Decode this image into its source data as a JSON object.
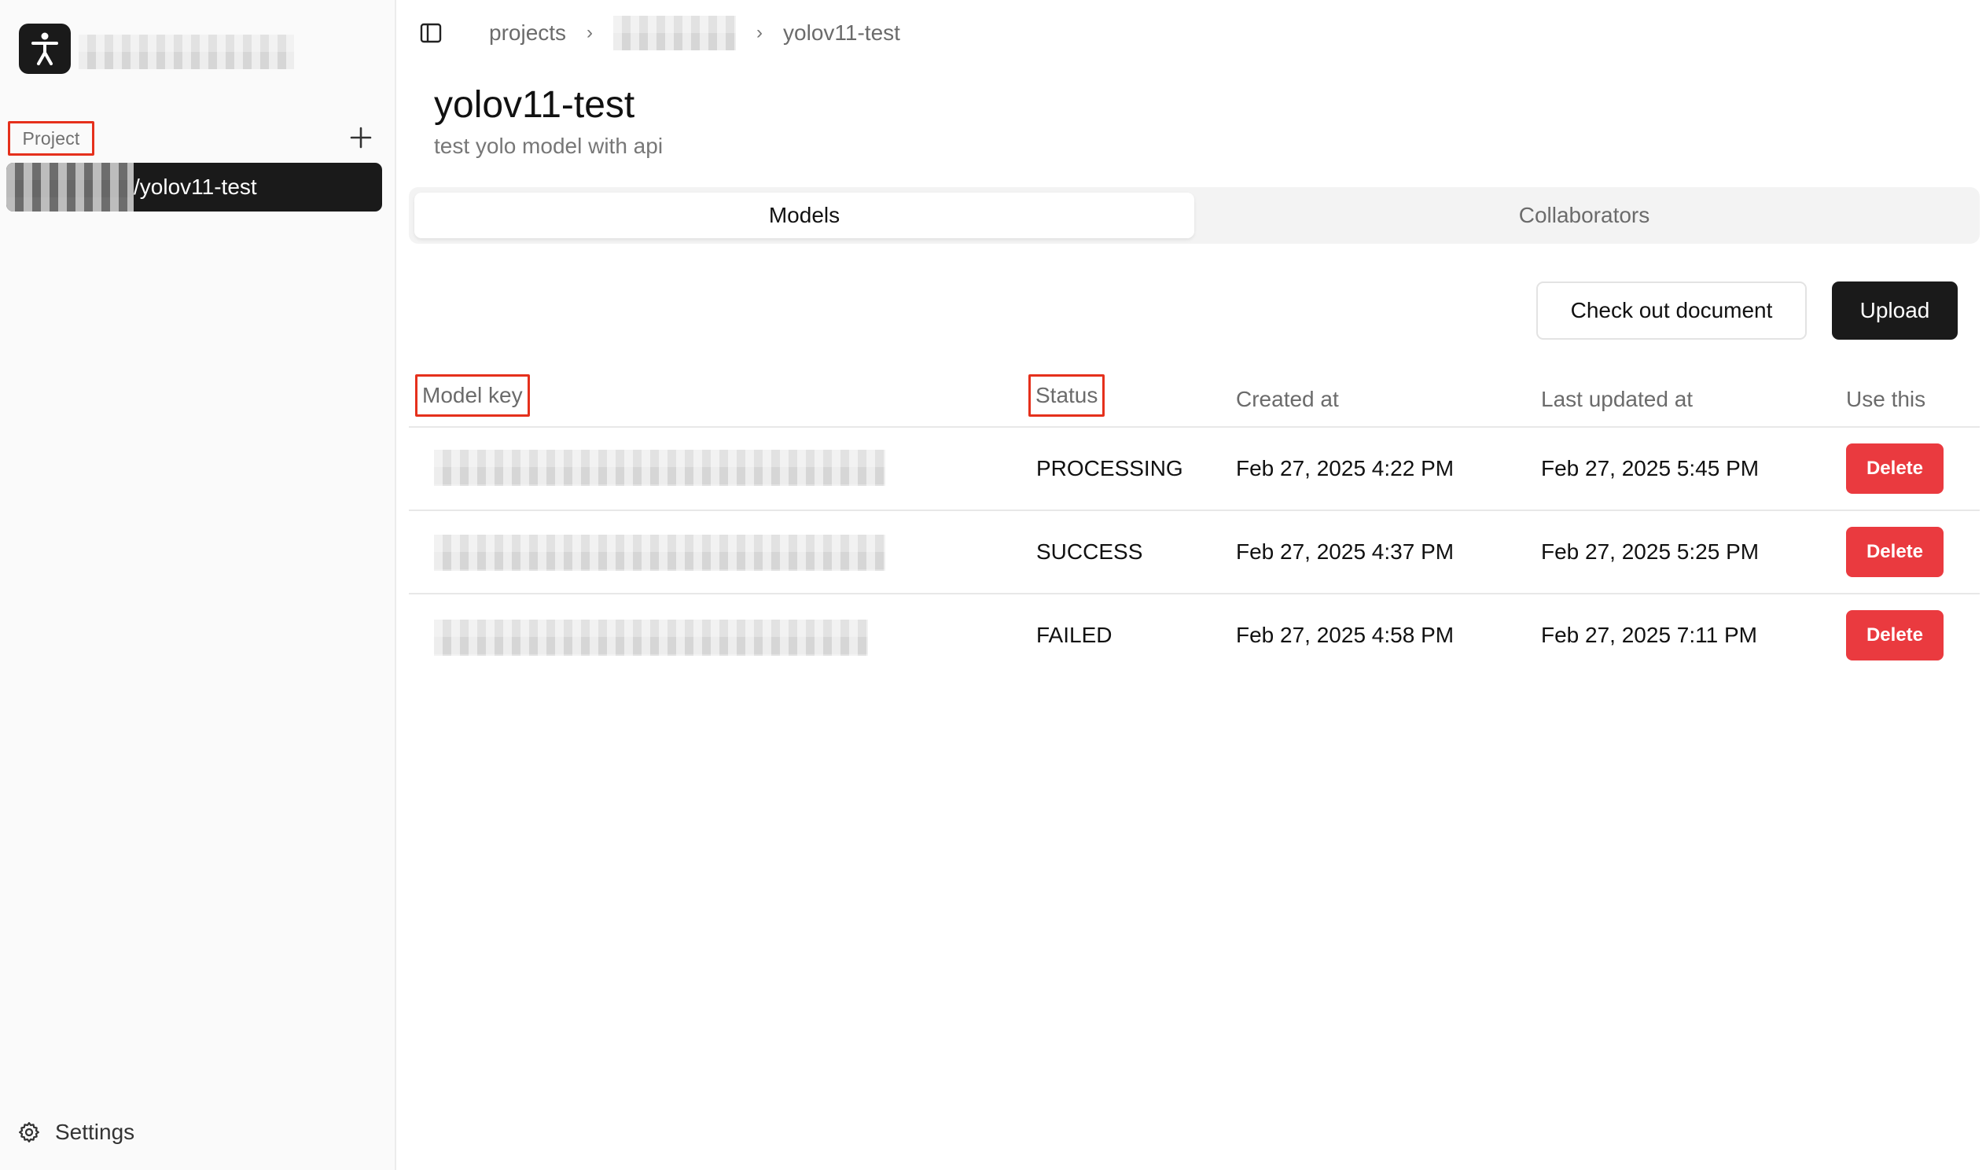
{
  "sidebar": {
    "section_label": "Project",
    "project_item_suffix": "/yolov11-test",
    "settings_label": "Settings"
  },
  "breadcrumb": {
    "root": "projects",
    "current": "yolov11-test"
  },
  "page": {
    "title": "yolov11-test",
    "subtitle": "test yolo model with api"
  },
  "tabs": [
    {
      "label": "Models",
      "active": true
    },
    {
      "label": "Collaborators",
      "active": false
    }
  ],
  "actions": {
    "doc_label": "Check out document",
    "upload_label": "Upload"
  },
  "table": {
    "headers": {
      "model_key": "Model key",
      "status": "Status",
      "created": "Created at",
      "updated": "Last updated at",
      "use": "Use this"
    },
    "rows": [
      {
        "status": "PROCESSING",
        "created": "Feb 27, 2025 4:22 PM",
        "updated": "Feb 27, 2025 5:45 PM",
        "action": "Delete"
      },
      {
        "status": "SUCCESS",
        "created": "Feb 27, 2025 4:37 PM",
        "updated": "Feb 27, 2025 5:25 PM",
        "action": "Delete"
      },
      {
        "status": "FAILED",
        "created": "Feb 27, 2025 4:58 PM",
        "updated": "Feb 27, 2025 7:11 PM",
        "action": "Delete"
      }
    ]
  },
  "icons": {
    "logo": "accessibility-person-icon",
    "add": "plus-icon",
    "panel": "sidebar-toggle-icon",
    "chevron": "chevron-right-icon",
    "settings": "gear-icon"
  },
  "colors": {
    "primary_dark": "#1a1a1a",
    "danger": "#ea3a3f",
    "highlight_box": "#e5301c"
  }
}
